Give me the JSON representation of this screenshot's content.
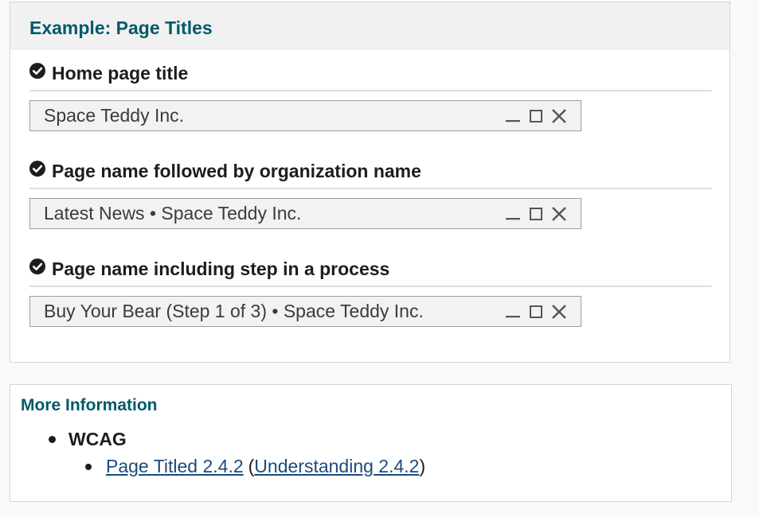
{
  "example": {
    "heading": "Example: Page Titles",
    "items": [
      {
        "title": "Home page title",
        "window_title": "Space Teddy Inc."
      },
      {
        "title": "Page name followed by organization name",
        "window_title": "Latest News • Space Teddy Inc."
      },
      {
        "title": "Page name including step in a process",
        "window_title": "Buy Your Bear (Step 1 of 3) • Space Teddy Inc."
      }
    ]
  },
  "more_info": {
    "heading": "More Information",
    "list_label": "WCAG",
    "link1": "Page Titled 2.4.2",
    "open_paren": "(",
    "link2": "Understanding 2.4.2",
    "close_paren": ")"
  },
  "icons": {
    "check": "check-circle-icon",
    "minimize": "minimize-icon",
    "maximize": "maximize-icon",
    "close": "close-icon"
  },
  "colors": {
    "heading_teal": "#005a6a",
    "link_blue": "#1c4a7d",
    "titlebar_bg": "#f2f2f2"
  }
}
